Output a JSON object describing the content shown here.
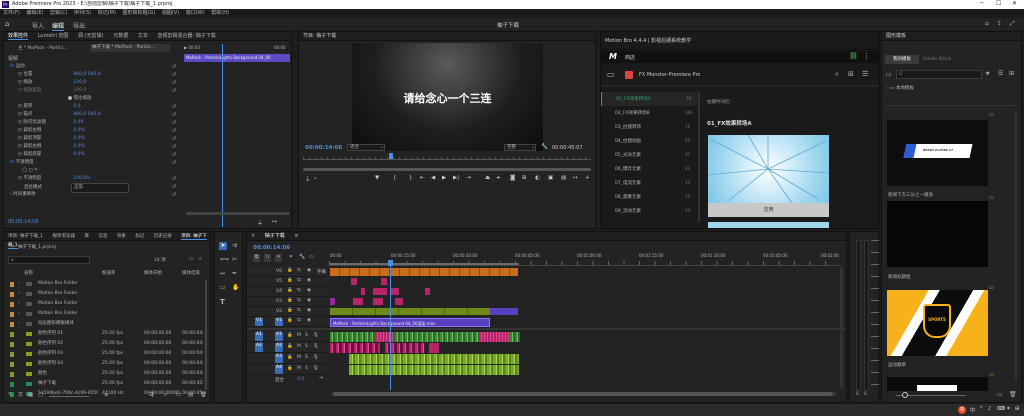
{
  "app": {
    "title": "Adobe Premiere Pro 2023 - E:\\自动剪辑\\柚子下载\\柚子下载_1.prproj",
    "tab_title": "柚子下载",
    "logo": "Pr"
  },
  "menu": [
    "文件(F)",
    "编辑(E)",
    "剪辑(C)",
    "序列(S)",
    "标记(M)",
    "图形和标题(G)",
    "视图(V)",
    "窗口(W)",
    "帮助(H)"
  ],
  "workspace": {
    "tabs": [
      "导入",
      "编辑",
      "导出"
    ],
    "active": "编辑",
    "center_title": "柚子下载"
  },
  "effect_controls": {
    "tabs": [
      "效果控件",
      "Lumetri 范围",
      "源:(无剪辑)",
      "元数据",
      "文本",
      "音频剪辑混合器: 柚子下载"
    ],
    "active_tab": "效果控件",
    "source_label": "主 * MoPack - Particl...",
    "seq_label": "柚子下载 * MoPack - Particl...",
    "section_video": "视频",
    "clip_name": "MoPack - ParticleLights Background 04_00",
    "props": [
      {
        "name": "运动",
        "value": ""
      },
      {
        "name": "位置",
        "value": "960.0   540.0"
      },
      {
        "name": "缩放",
        "value": "100.0"
      },
      {
        "name": "缩放宽度",
        "value": "100.0"
      },
      {
        "name": "",
        "value": "等比缩放"
      },
      {
        "name": "旋转",
        "value": "0.0"
      },
      {
        "name": "锚点",
        "value": "960.0   540.0"
      },
      {
        "name": "防闪烁滤镜",
        "value": "0.00"
      },
      {
        "name": "裁剪左侧",
        "value": "0.0%"
      },
      {
        "name": "裁剪顶部",
        "value": "0.0%"
      },
      {
        "name": "裁剪右侧",
        "value": "0.0%"
      },
      {
        "name": "裁剪底部",
        "value": "0.0%"
      },
      {
        "name": "不透明度",
        "value": ""
      },
      {
        "name": "",
        "value": ""
      },
      {
        "name": "不透明度",
        "value": "100.0%"
      },
      {
        "name": "混合模式",
        "value": "正常"
      },
      {
        "name": "时间重映射",
        "value": ""
      }
    ],
    "timecode": "00:00:14:06"
  },
  "program": {
    "title": "节目: 柚子下载",
    "overlay_text": "请给念心一个三连",
    "timecode": "00:00:14:06",
    "fit": "适合",
    "quality": "完整",
    "duration": "00:00:45:07"
  },
  "plugin": {
    "title": "Motion Bro 4.4.4 | 影视后期系统教学",
    "logo": "M",
    "tab": "商店",
    "pack": "FX Monster-Premiere Pro",
    "categories": [
      {
        "name": "01_FX效果转场A",
        "count": "79"
      },
      {
        "name": "02_FX效果转场B",
        "count": "140"
      },
      {
        "name": "03_拉镜转场",
        "count": "71"
      },
      {
        "name": "04_拉镜动画",
        "count": "25"
      },
      {
        "name": "05_光效元素",
        "count": "37"
      },
      {
        "name": "06_爆炸元素",
        "count": "42"
      },
      {
        "name": "07_电流元素",
        "count": "14"
      },
      {
        "name": "08_漏墨元素",
        "count": "15"
      },
      {
        "name": "09_流动元素",
        "count": "14"
      }
    ],
    "breadcrumb": "拍摄时间栏:",
    "preview_title": "01_FX效果转场A",
    "apply": "应用"
  },
  "essential_graphics": {
    "title": "图形模板",
    "tabs": [
      "我的模板",
      "Adobe Stock"
    ],
    "search_placeholder": "Q",
    "folder": "本地模板",
    "items": [
      "新闻下方三分之一播放",
      "新闻标题框",
      "运动徽章",
      "剧集"
    ],
    "badge_text": "READY PLAYER 17",
    "sports_text": "SPORTS"
  },
  "project": {
    "tabs": [
      "项目: 柚子下载_1",
      "媒体浏览器",
      "库",
      "信息",
      "效果",
      "标记",
      "历史记录",
      "项目: 柚子下载_1"
    ],
    "path": "柚子下载_1.prproj",
    "count": "14 项",
    "columns": [
      "名称",
      "帧速率",
      "媒体开始",
      "媒体结束"
    ],
    "rows": [
      {
        "name": "Motion Bro Folder",
        "fps": "",
        "start": "",
        "end": "",
        "color": "#c58a3a"
      },
      {
        "name": "Motion Bro Folder",
        "fps": "",
        "start": "",
        "end": "",
        "color": "#c58a3a"
      },
      {
        "name": "Motion Bro Folder",
        "fps": "",
        "start": "",
        "end": "",
        "color": "#c58a3a"
      },
      {
        "name": "Motion Bro Folder",
        "fps": "",
        "start": "",
        "end": "",
        "color": "#c58a3a"
      },
      {
        "name": "动态图形模板媒体",
        "fps": "",
        "start": "",
        "end": "",
        "color": "#c58a3a"
      },
      {
        "name": "颜色序列 01",
        "fps": "25.00 fps",
        "start": "00:00:00:00",
        "end": "00:00:04:",
        "color": "#8a9a2a"
      },
      {
        "name": "颜色序列 02",
        "fps": "25.00 fps",
        "start": "00:00:00:00",
        "end": "00:00:04:",
        "color": "#8a9a2a"
      },
      {
        "name": "颜色序列 03",
        "fps": "25.00 fps",
        "start": "00:00:00:00",
        "end": "00:00:04:",
        "color": "#8a9a2a"
      },
      {
        "name": "颜色序列 04",
        "fps": "25.00 fps",
        "start": "00:00:00:00",
        "end": "00:00:04:",
        "color": "#8a9a2a"
      },
      {
        "name": "颜色",
        "fps": "25.00 fps",
        "start": "00:00:00:00",
        "end": "00:00:04:",
        "color": "#8a9a2a"
      },
      {
        "name": "柚子下载",
        "fps": "25.00 fps",
        "start": "00:00:00:00",
        "end": "00:00:45:",
        "color": "#2a8a5a"
      },
      {
        "name": "5a594be0-706c-4c09-9559",
        "fps": "44100 Hz",
        "start": "00:00:00:00000",
        "end": "00:00:45:",
        "color": "#2a8a5a"
      }
    ]
  },
  "timeline": {
    "title": "柚子下载",
    "timecode": "00:00:14:06",
    "ruler": [
      "00:00",
      "00:00:15:00",
      "00:00:30:00",
      "00:00:45:00",
      "00:01:00:00",
      "00:01:15:00",
      "00:01:30:00",
      "00:01:45:00",
      "00:02:00"
    ],
    "video_tracks": [
      "V6",
      "V5",
      "V4",
      "V3",
      "V2",
      "V1"
    ],
    "audio_tracks": [
      "A1",
      "A2",
      "A3",
      "A4"
    ],
    "mix_label": "混合",
    "mix_value": "0.0",
    "caption_label": "字幕",
    "v1_clip": "MoPack - ParticleLights Background 04_00渲染.mov"
  },
  "statusbar": {
    "ime": "中",
    "items": [
      "S",
      "中",
      "°",
      "♪",
      "⌨",
      "✦",
      "⊞"
    ]
  }
}
